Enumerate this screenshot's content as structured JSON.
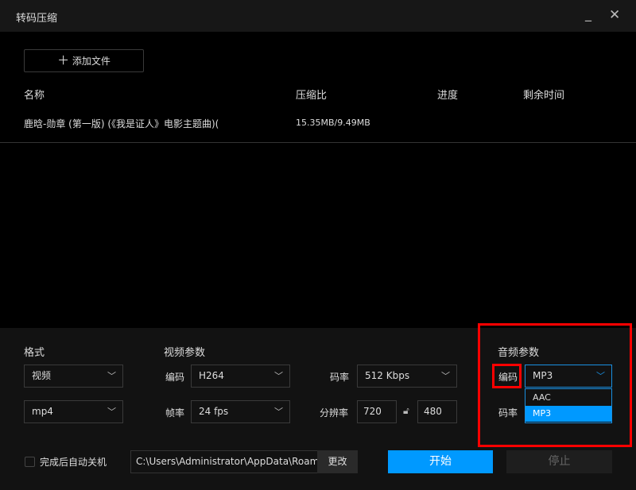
{
  "window": {
    "title": "转码压缩",
    "minimize_icon": "minimize-icon",
    "close_icon": "close-icon"
  },
  "toolbar": {
    "add_file": "添加文件",
    "add_icon": "plus-icon"
  },
  "table": {
    "headers": [
      "名称",
      "压缩比",
      "进度",
      "剩余时间"
    ],
    "rows": [
      {
        "name": "鹿晗-勋章 (第一版) (《我是证人》电影主题曲)(",
        "ratio": "15.35MB/9.49MB",
        "progress": "",
        "remaining": ""
      }
    ]
  },
  "format": {
    "title": "格式",
    "type": "视频",
    "container": "mp4"
  },
  "video": {
    "title": "视频参数",
    "codec_label": "编码",
    "codec": "H264",
    "bitrate_label": "码率",
    "bitrate": "512 Kbps",
    "fps_label": "帧率",
    "fps": "24 fps",
    "resolution_label": "分辨率",
    "width": "720",
    "height": "480"
  },
  "audio": {
    "title": "音频参数",
    "codec_label": "编码",
    "codec": "MP3",
    "bitrate_label": "码率",
    "options": [
      "AAC",
      "MP3"
    ],
    "selected": "MP3"
  },
  "footer": {
    "shutdown_label": "完成后自动关机",
    "shutdown_checked": false,
    "path": "C:\\Users\\Administrator\\AppData\\Roaming",
    "change": "更改",
    "start": "开始",
    "stop": "停止"
  },
  "colors": {
    "accent": "#0099ff",
    "highlight": "#ff0000"
  }
}
